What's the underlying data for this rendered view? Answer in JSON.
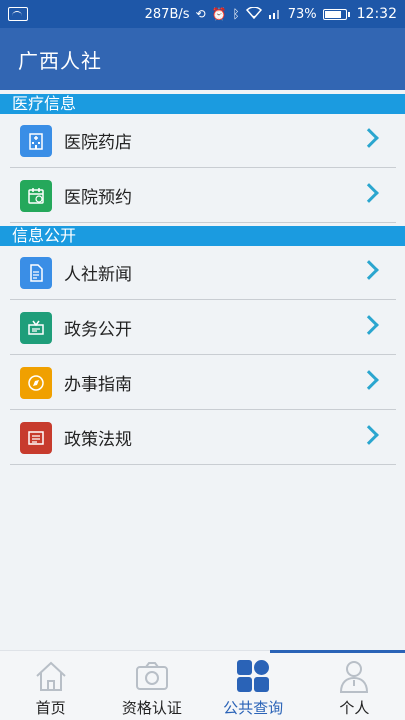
{
  "status_bar": {
    "speed": "287B/s",
    "battery": "73%",
    "time": "12:32"
  },
  "header": {
    "title": "广西人社"
  },
  "sections": [
    {
      "title": "医疗信息",
      "items": [
        {
          "label": "医院药店",
          "icon": "hospital-building-icon",
          "color": "#3a8ee6"
        },
        {
          "label": "医院预约",
          "icon": "calendar-clock-icon",
          "color": "#25a85b"
        }
      ]
    },
    {
      "title": "信息公开",
      "items": [
        {
          "label": "人社新闻",
          "icon": "document-icon",
          "color": "#3a8ee6"
        },
        {
          "label": "政务公开",
          "icon": "notice-board-icon",
          "color": "#1f9e7a"
        },
        {
          "label": "办事指南",
          "icon": "compass-icon",
          "color": "#f0a000"
        },
        {
          "label": "政策法规",
          "icon": "law-book-icon",
          "color": "#c73b2d"
        }
      ]
    }
  ],
  "bottom_nav": [
    {
      "label": "首页",
      "icon": "home-icon",
      "active": false
    },
    {
      "label": "资格认证",
      "icon": "camera-icon",
      "active": false
    },
    {
      "label": "公共查询",
      "icon": "grid-query-icon",
      "active": true
    },
    {
      "label": "个人",
      "icon": "person-icon",
      "active": false
    }
  ],
  "colors": {
    "status_bar": "#1e57a8",
    "header": "#3266b3",
    "section_header": "#1b9be0",
    "chevron": "#2ba6cf",
    "nav_active": "#2a63b7"
  }
}
